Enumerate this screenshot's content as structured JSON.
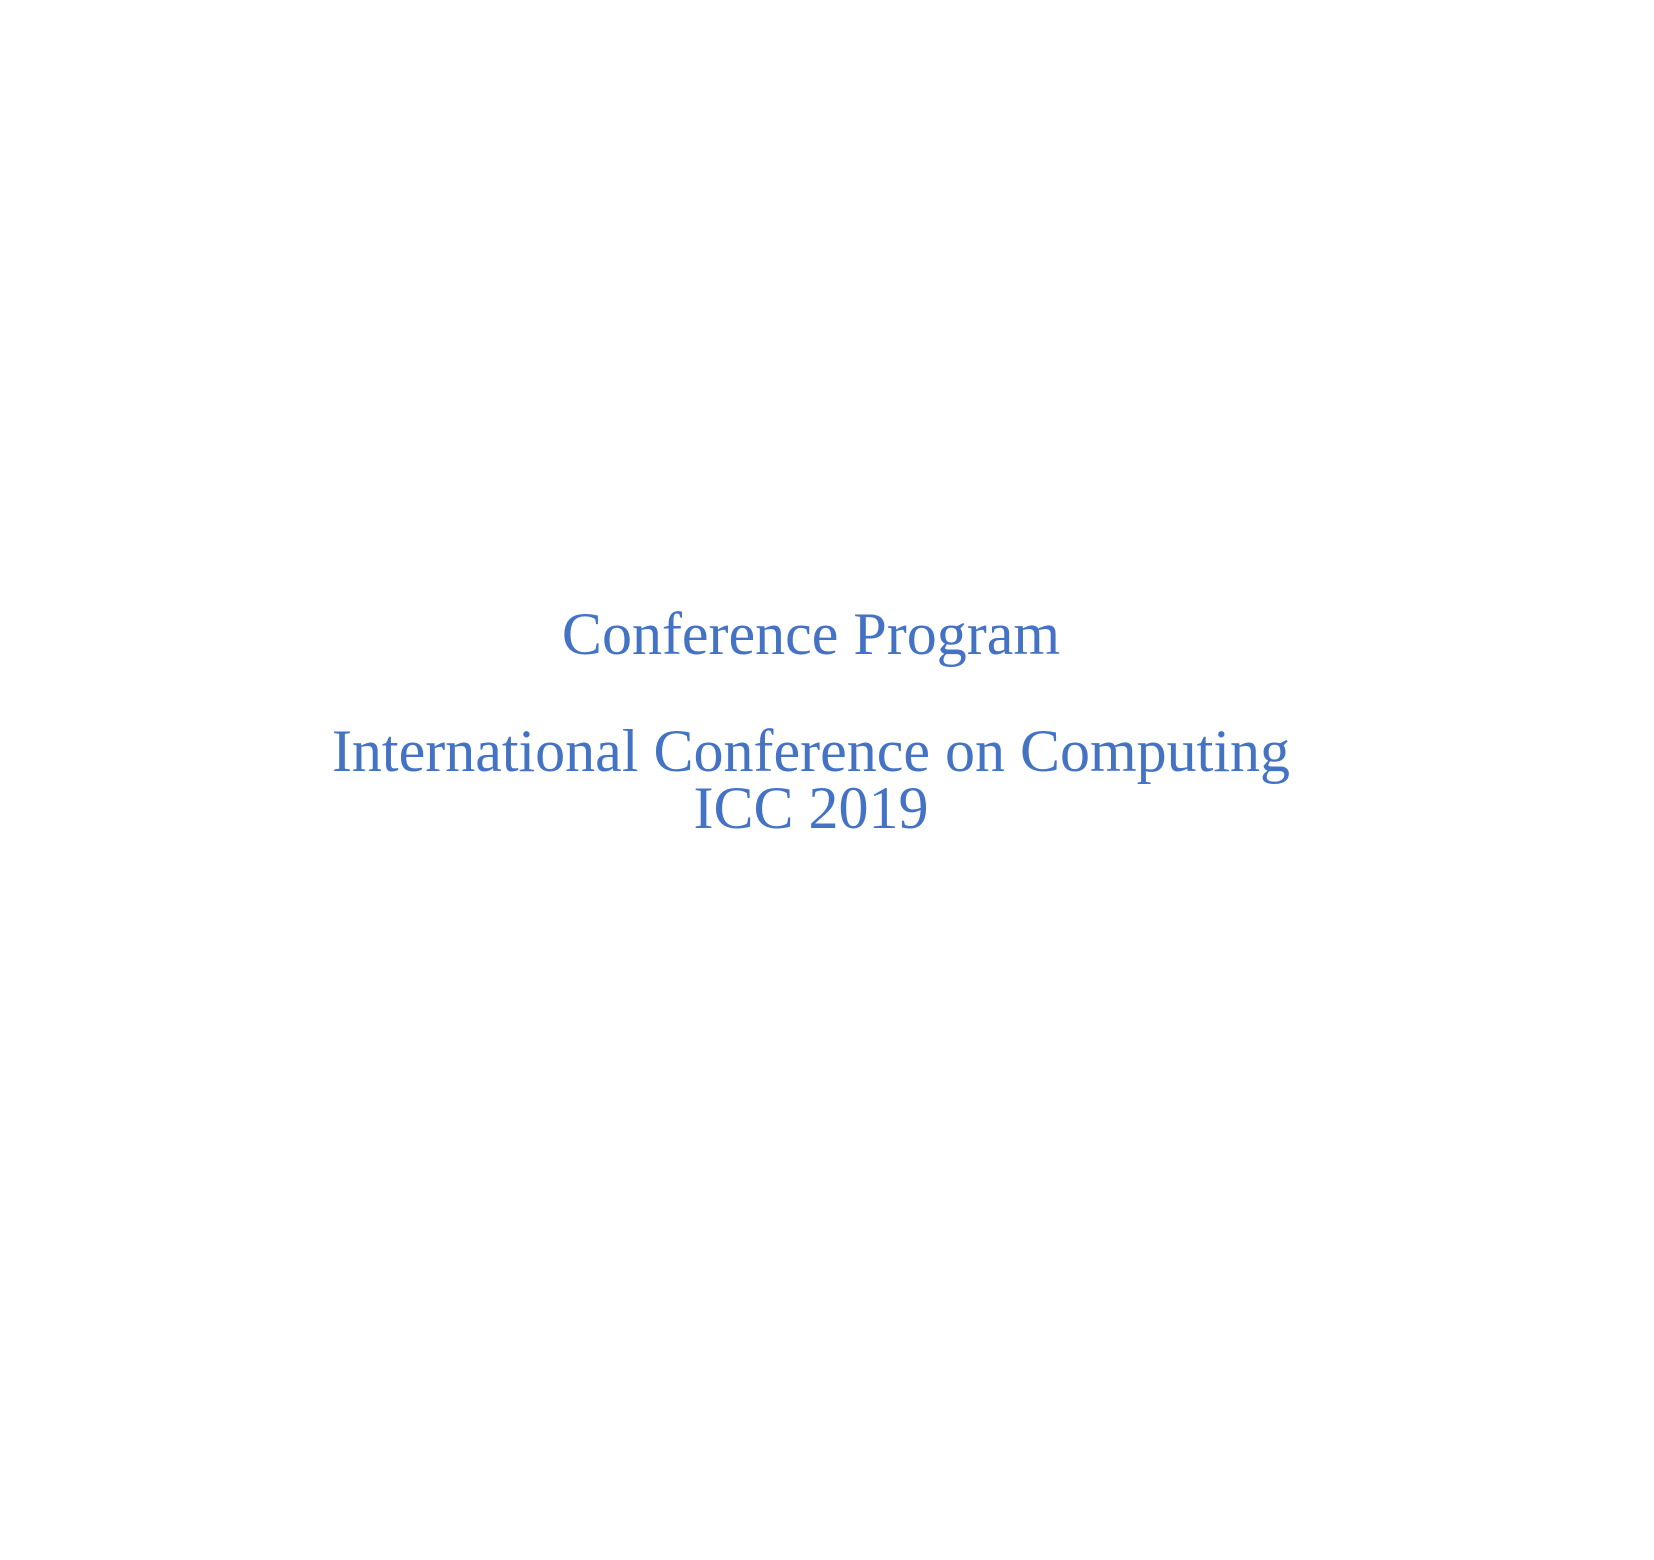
{
  "document": {
    "title": "Conference Program",
    "conference_name": "International Conference on Computing",
    "conference_short": "ICC 2019",
    "text_color": "#4472c4"
  }
}
